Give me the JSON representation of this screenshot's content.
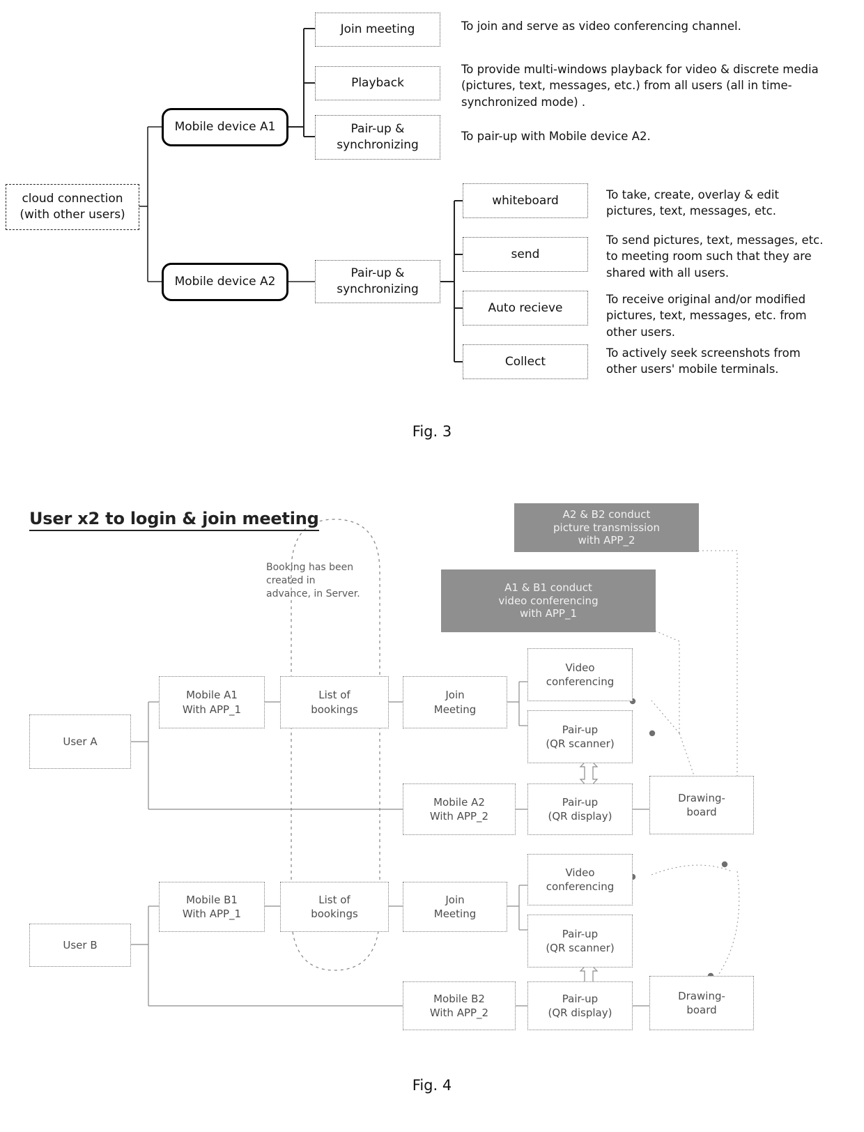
{
  "figures": [
    {
      "id": "fig3",
      "caption": "Fig. 3",
      "title": "Mobile device capability tree",
      "root": {
        "label": "cloud connection",
        "label2": "(with other users)"
      },
      "branches": [
        {
          "device": "Mobile device A1",
          "functions": [
            {
              "label": "Join meeting",
              "label2": "",
              "description": "To join and serve as video conferencing channel."
            },
            {
              "label": "Playback",
              "label2": "",
              "description": "To provide multi-windows playback for video & discrete media (pictures, text, messages, etc.) from all users (all in time-synchronized mode) ."
            },
            {
              "label": "Pair-up &",
              "label2": "synchronizing",
              "description": "To pair-up with Mobile device A2."
            }
          ]
        },
        {
          "device": "Mobile device A2",
          "mid": {
            "label": "Pair-up &",
            "label2": "synchronizing"
          },
          "functions": [
            {
              "label": "whiteboard",
              "label2": "",
              "description": "To take, create, overlay & edit pictures, text, messages, etc."
            },
            {
              "label": "send",
              "label2": "",
              "description": "To send pictures, text, messages, etc. to meeting room such that they are shared with all users."
            },
            {
              "label": "Auto recieve",
              "label2": "",
              "description": "To receive original and/or modified pictures, text, messages, etc. from other users."
            },
            {
              "label": "Collect",
              "label2": "",
              "description": "To actively seek screenshots from other users' mobile terminals."
            }
          ]
        }
      ]
    },
    {
      "id": "fig4",
      "caption": "Fig. 4",
      "title": "User x2 to login & join meeting",
      "note": "Booking has been created in advance, in Server.",
      "grey_callouts": [
        {
          "line1": "A2 & B2 conduct",
          "line2": "picture transmission",
          "line3": "with APP_2"
        },
        {
          "line1": "A1 & B1 conduct",
          "line2": "video conferencing",
          "line3": "with APP_1"
        }
      ],
      "lanes": [
        {
          "user": "User A",
          "mobile_primary": {
            "line1": "Mobile A1",
            "line2": "With APP_1"
          },
          "bookings": {
            "line1": "List of",
            "line2": "bookings"
          },
          "join": {
            "line1": "Join",
            "line2": "Meeting"
          },
          "video": {
            "line1": "Video",
            "line2": "conferencing"
          },
          "pair_scanner": {
            "line1": "Pair-up",
            "line2": "(QR scanner)"
          },
          "mobile_secondary": {
            "line1": "Mobile A2",
            "line2": "With APP_2"
          },
          "pair_display": {
            "line1": "Pair-up",
            "line2": "(QR display)"
          },
          "drawing": {
            "line1": "Drawing-",
            "line2": "board"
          }
        },
        {
          "user": "User B",
          "mobile_primary": {
            "line1": "Mobile B1",
            "line2": "With APP_1"
          },
          "bookings": {
            "line1": "List of",
            "line2": "bookings"
          },
          "join": {
            "line1": "Join",
            "line2": "Meeting"
          },
          "video": {
            "line1": "Video",
            "line2": "conferencing"
          },
          "pair_scanner": {
            "line1": "Pair-up",
            "line2": "(QR scanner)"
          },
          "mobile_secondary": {
            "line1": "Mobile B2",
            "line2": "With APP_2"
          },
          "pair_display": {
            "line1": "Pair-up",
            "line2": "(QR display)"
          },
          "drawing": {
            "line1": "Drawing-",
            "line2": "board"
          }
        }
      ]
    }
  ],
  "colors": {
    "grey_callout_bg": "#8f8f8f",
    "grey_callout_text": "#f2f2f2",
    "box_border": "#7a7a7a",
    "ink": "#111111"
  }
}
